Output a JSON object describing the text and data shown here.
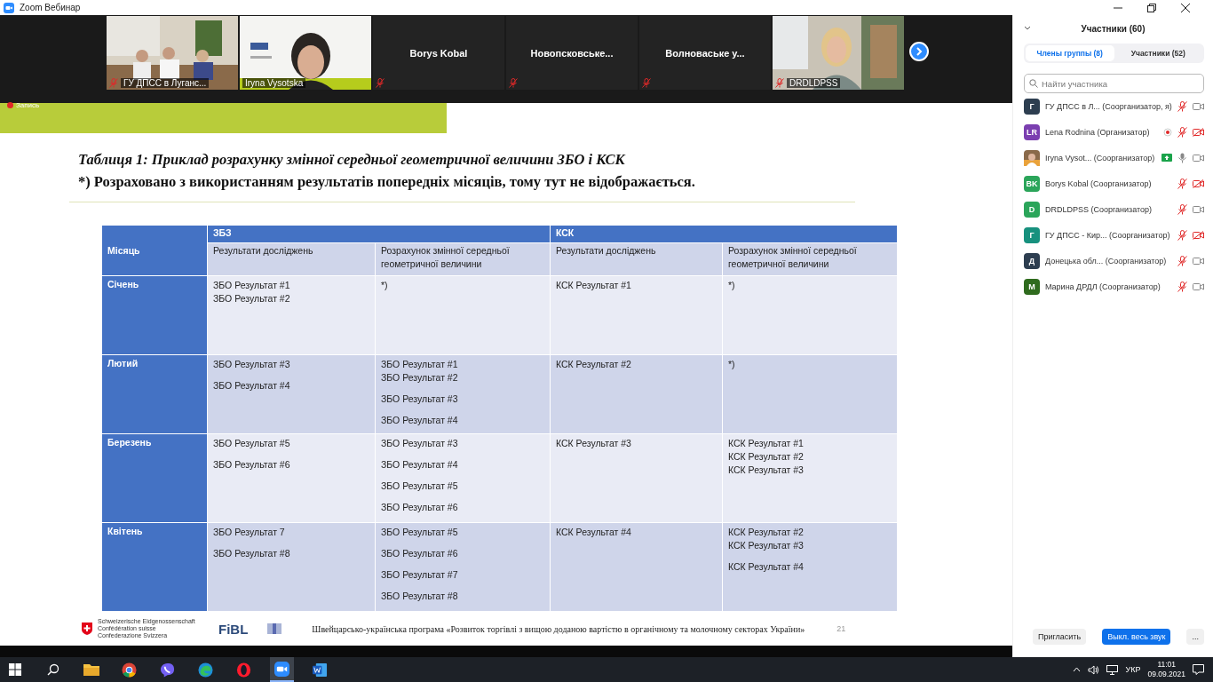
{
  "window": {
    "title": "Zoom Вебинар"
  },
  "video_strip": [
    {
      "kind": "video",
      "name": "ГУ ДПСС в Луганс...",
      "muted": true,
      "speaking": false
    },
    {
      "kind": "video",
      "name": "Iryna Vysotska",
      "muted": false,
      "speaking": true
    },
    {
      "kind": "name",
      "name": "Borys Kobal",
      "muted": true,
      "speaking": false
    },
    {
      "kind": "name",
      "name": "Новопсковське...",
      "muted": true,
      "speaking": false
    },
    {
      "kind": "name",
      "name": "Волноваське  у...",
      "muted": true,
      "speaking": false
    },
    {
      "kind": "video",
      "name": "DRDLDPSS",
      "muted": true,
      "speaking": false
    }
  ],
  "recording": {
    "label": "Запись"
  },
  "slide": {
    "title": "Таблиця 1: Приклад розрахунку змінної середньої геометричної величини ЗБО і КСК",
    "note": "*) Розраховано з використанням результатів попередніх місяців, тому тут не відображається.",
    "table": {
      "month_header": "Місяць",
      "groups": [
        "ЗБЗ",
        "КСК"
      ],
      "subheaders": [
        "Результати досліджень",
        "Розрахунок змінної середньої геометричної величини",
        "Результати досліджень",
        "Розрахунок змінної середньої геометричної величини"
      ],
      "rows": [
        {
          "month": "Січень",
          "cells": [
            [
              [
                "ЗБО Результат #1",
                "ЗБО Результат #2"
              ]
            ],
            [
              [
                "*)"
              ]
            ],
            [
              [
                "КСК Результат #1"
              ]
            ],
            [
              [
                "*)"
              ]
            ]
          ]
        },
        {
          "month": "Лютий",
          "cells": [
            [
              [
                "ЗБО Результат #3"
              ],
              [
                "ЗБО Результат #4"
              ]
            ],
            [
              [
                "ЗБО Результат #1",
                "ЗБО Результат #2"
              ],
              [
                "ЗБО Результат #3"
              ],
              [
                "ЗБО Результат #4"
              ]
            ],
            [
              [
                "КСК Результат #2"
              ]
            ],
            [
              [
                "*)"
              ]
            ]
          ]
        },
        {
          "month": "Березень",
          "cells": [
            [
              [
                "ЗБО Результат #5"
              ],
              [
                "ЗБО Результат #6"
              ]
            ],
            [
              [
                "ЗБО Результат #3"
              ],
              [
                "ЗБО Результат #4"
              ],
              [
                "ЗБО Результат #5"
              ],
              [
                "ЗБО Результат #6"
              ]
            ],
            [
              [
                "КСК Результат #3"
              ]
            ],
            [
              [
                "КСК Результат #1",
                "КСК Результат #2",
                "КСК Результат #3"
              ]
            ]
          ]
        },
        {
          "month": "Квітень",
          "cells": [
            [
              [
                "ЗБО Результат 7"
              ],
              [
                "ЗБО Результат #8"
              ]
            ],
            [
              [
                "ЗБО Результат #5"
              ],
              [
                "ЗБО Результат #6"
              ],
              [
                "ЗБО Результат #7"
              ],
              [
                "ЗБО Результат #8"
              ]
            ],
            [
              [
                "КСК Результат #4"
              ]
            ],
            [
              [
                "КСК Результат #2",
                "КСК Результат #3"
              ],
              [
                "КСК Результат #4"
              ]
            ]
          ]
        }
      ]
    },
    "footer": {
      "logo_lines": [
        "Schweizerische Eidgenossenschaft",
        "Confédération suisse",
        "Confederazione Svizzera"
      ],
      "logo2": "FiBL",
      "text": "Швейцарсько-українська програма «Розвиток торгівлі з вищою доданою вартістю в органічному та молочному секторах України»",
      "page": "21"
    }
  },
  "participants": {
    "title": "Участники (60)",
    "tabs": [
      {
        "label": "Члены группы (8)",
        "selected": true
      },
      {
        "label": "Участники (52)",
        "selected": false
      }
    ],
    "search": {
      "placeholder": "Найти участника"
    },
    "items": [
      {
        "kind": "initials",
        "avatar": "Г",
        "color": "#2d3e50",
        "name": "ГУ ДПСС в Л... (Соорганизатор, я)",
        "recording": false,
        "sharing": false,
        "muted": true,
        "video_off": false
      },
      {
        "kind": "initials",
        "avatar": "LR",
        "color": "#7b3fb0",
        "name": "Lena Rodnina (Организатор)",
        "recording": true,
        "sharing": false,
        "muted": true,
        "video_off": true
      },
      {
        "color": "#8a6a4a",
        "name": "Iryna Vysot... (Соорганизатор)",
        "recording": false,
        "sharing": true,
        "muted": false,
        "video_off": false
      },
      {
        "kind": "initials",
        "avatar": "BK",
        "color": "#2ba55a",
        "name": "Borys Kobal (Соорганизатор)",
        "recording": false,
        "sharing": false,
        "muted": true,
        "video_off": true
      },
      {
        "kind": "initials",
        "avatar": "D",
        "color": "#2ba55a",
        "name": "DRDLDPSS (Соорганизатор)",
        "recording": false,
        "sharing": false,
        "muted": true,
        "video_off": false
      },
      {
        "kind": "initials",
        "avatar": "Г",
        "color": "#17917e",
        "name": "ГУ ДПСС - Кир... (Соорганизатор)",
        "recording": false,
        "sharing": false,
        "muted": true,
        "video_off": true
      },
      {
        "kind": "initials",
        "avatar": "Д",
        "color": "#2d3e50",
        "name": "Донецька обл... (Соорганизатор)",
        "recording": false,
        "sharing": false,
        "muted": true,
        "video_off": false
      },
      {
        "kind": "initials",
        "avatar": "М",
        "color": "#2f6b1e",
        "name": "Марина ДРДЛ (Соорганизатор)",
        "recording": false,
        "sharing": false,
        "muted": true,
        "video_off": false
      }
    ],
    "buttons": [
      {
        "label": "Пригласить",
        "kind": "plain"
      },
      {
        "label": "Выкл. весь звук",
        "kind": "primary"
      },
      {
        "label": "...",
        "kind": "more"
      }
    ]
  },
  "taskbar": {
    "apps": [
      {
        "kind": "windows",
        "selected": false
      },
      {
        "kind": "search",
        "selected": false
      },
      {
        "kind": "folder",
        "selected": false
      },
      {
        "kind": "chrome",
        "selected": false
      },
      {
        "kind": "viber",
        "selected": false
      },
      {
        "kind": "edge",
        "selected": false
      },
      {
        "kind": "opera",
        "selected": false
      },
      {
        "kind": "zoom",
        "selected": true
      },
      {
        "kind": "word",
        "selected": false
      }
    ],
    "language": "УКР",
    "time": "11:01",
    "date": "09.09.2021"
  }
}
